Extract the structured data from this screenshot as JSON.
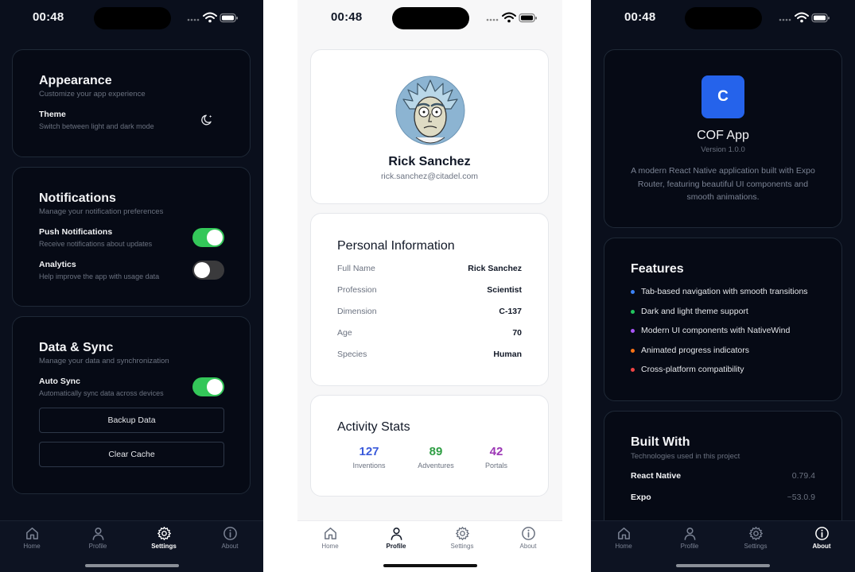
{
  "status_bar": {
    "time": "00:48"
  },
  "tabs": {
    "home": "Home",
    "profile": "Profile",
    "settings": "Settings",
    "about": "About"
  },
  "settings_screen": {
    "appearance": {
      "title": "Appearance",
      "subtitle": "Customize your app experience",
      "theme_title": "Theme",
      "theme_sub": "Switch between light and dark mode",
      "theme_icon": "moon-icon"
    },
    "notifications": {
      "title": "Notifications",
      "subtitle": "Manage your notification preferences",
      "push_title": "Push Notifications",
      "push_sub": "Receive notifications about updates",
      "push_on": true,
      "analytics_title": "Analytics",
      "analytics_sub": "Help improve the app with usage data",
      "analytics_on": false
    },
    "data_sync": {
      "title": "Data & Sync",
      "subtitle": "Manage your data and synchronization",
      "auto_sync_title": "Auto Sync",
      "auto_sync_sub": "Automatically sync data across devices",
      "auto_sync_on": true,
      "backup_label": "Backup Data",
      "clear_cache_label": "Clear Cache"
    }
  },
  "profile_screen": {
    "name": "Rick Sanchez",
    "email": "rick.sanchez@citadel.com",
    "personal": {
      "title": "Personal Information",
      "rows": [
        {
          "label": "Full Name",
          "value": "Rick Sanchez"
        },
        {
          "label": "Profession",
          "value": "Scientist"
        },
        {
          "label": "Dimension",
          "value": "C-137"
        },
        {
          "label": "Age",
          "value": "70"
        },
        {
          "label": "Species",
          "value": "Human"
        }
      ]
    },
    "activity": {
      "title": "Activity Stats",
      "stats": [
        {
          "value": "127",
          "label": "Inventions",
          "color": "#3b5bdb"
        },
        {
          "value": "89",
          "label": "Adventures",
          "color": "#2f9e44"
        },
        {
          "value": "42",
          "label": "Portals",
          "color": "#9c36b5"
        }
      ]
    }
  },
  "about_screen": {
    "app_icon_letter": "C",
    "app_name": "COF App",
    "version": "Version 1.0.0",
    "description": "A modern React Native application built with Expo Router, featuring beautiful UI components and smooth animations.",
    "features": {
      "title": "Features",
      "items": [
        {
          "text": "Tab-based navigation with smooth transitions",
          "color": "#3b82f6"
        },
        {
          "text": "Dark and light theme support",
          "color": "#22c55e"
        },
        {
          "text": "Modern UI components with NativeWind",
          "color": "#a855f7"
        },
        {
          "text": "Animated progress indicators",
          "color": "#f97316"
        },
        {
          "text": "Cross-platform compatibility",
          "color": "#ef4444"
        }
      ]
    },
    "built_with": {
      "title": "Built With",
      "subtitle": "Technologies used in this project",
      "items": [
        {
          "name": "React Native",
          "version": "0.79.4"
        },
        {
          "name": "Expo",
          "version": "~53.0.9"
        }
      ]
    }
  },
  "colors": {
    "accent_blue": "#2563eb",
    "toggle_on": "#34c759",
    "dark_bg": "#0a0f1c"
  }
}
